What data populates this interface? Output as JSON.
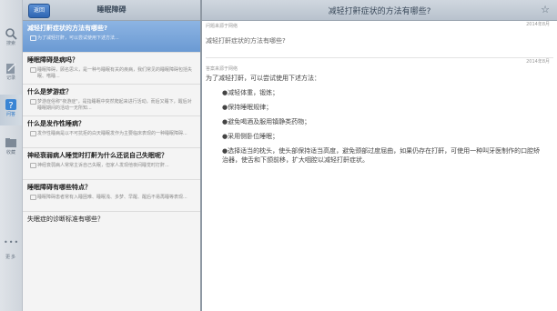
{
  "tabs": [
    {
      "icon": "search-icon",
      "label": "搜索"
    },
    {
      "icon": "notes-icon",
      "label": "记录"
    },
    {
      "icon": "question-icon",
      "label": "问答"
    },
    {
      "icon": "folder-icon",
      "label": "收藏"
    }
  ],
  "more": {
    "icon": "more-icon",
    "label": "更多"
  },
  "list": {
    "back_label": "返回",
    "title": "睡眠障碍",
    "items": [
      {
        "title": "减轻打鼾症状的方法有哪些?",
        "answer": "为了减轻打鼾，可以尝试使用下述方法..."
      },
      {
        "title": "睡眠障碍是病吗？",
        "answer": "睡眠障碍，顾名思义，是一种与睡眠有关的疾病，我们常见的睡眠障碍包括失眠、嗜睡..."
      },
      {
        "title": "什么是梦游症？",
        "answer": "梦游症俗称\"夜游症\"，是指睡眠中突然爬起来进行活动，而后又睡下，醒后对睡眠期间的活动一无所知..."
      },
      {
        "title": "什么是发作性睡病？",
        "answer": "发作性睡病是以不可抗拒的白天睡眠发作为主要临床表现的一种睡眠障碍..."
      },
      {
        "title": "神经衰弱病人睡觉时打鼾为什么还说自己失眠呢？",
        "answer": "神经衰弱病人常常主诉自己失眠，但家人发现他夜间睡觉时打鼾..."
      },
      {
        "title": "睡眠障碍有哪些特点？",
        "answer": "睡眠障碍患者常有入睡困难、睡眠浅、多梦、早醒、醒后不易再睡等表现..."
      },
      {
        "title": "失眠症的诊断标准有哪些？",
        "answer": ""
      }
    ]
  },
  "detail": {
    "title": "减轻打鼾症状的方法有哪些?",
    "question": {
      "meta": "问题来源于网络",
      "date": "2014年8月",
      "text": "减轻打鼾症状的方法有哪些?"
    },
    "answer": {
      "meta": "答案来源于网络",
      "date": "2014年8月",
      "intro": "为了减轻打鼾，可以尝试使用下述方法：",
      "bullets": [
        "●减轻体重，锻炼；",
        "●保持睡眠规律；",
        "●避免喝酒及服用镇静类药物；",
        "●采用侧卧位睡眠；",
        "●选择适当的枕头，使头部保持适当高度，避免颈部过度屈曲，如果仍存在打鼾，可使用一种叫牙医制作的口腔矫治器，使舌和下颌前移，扩大咽腔以减轻打鼾症状。"
      ]
    }
  }
}
